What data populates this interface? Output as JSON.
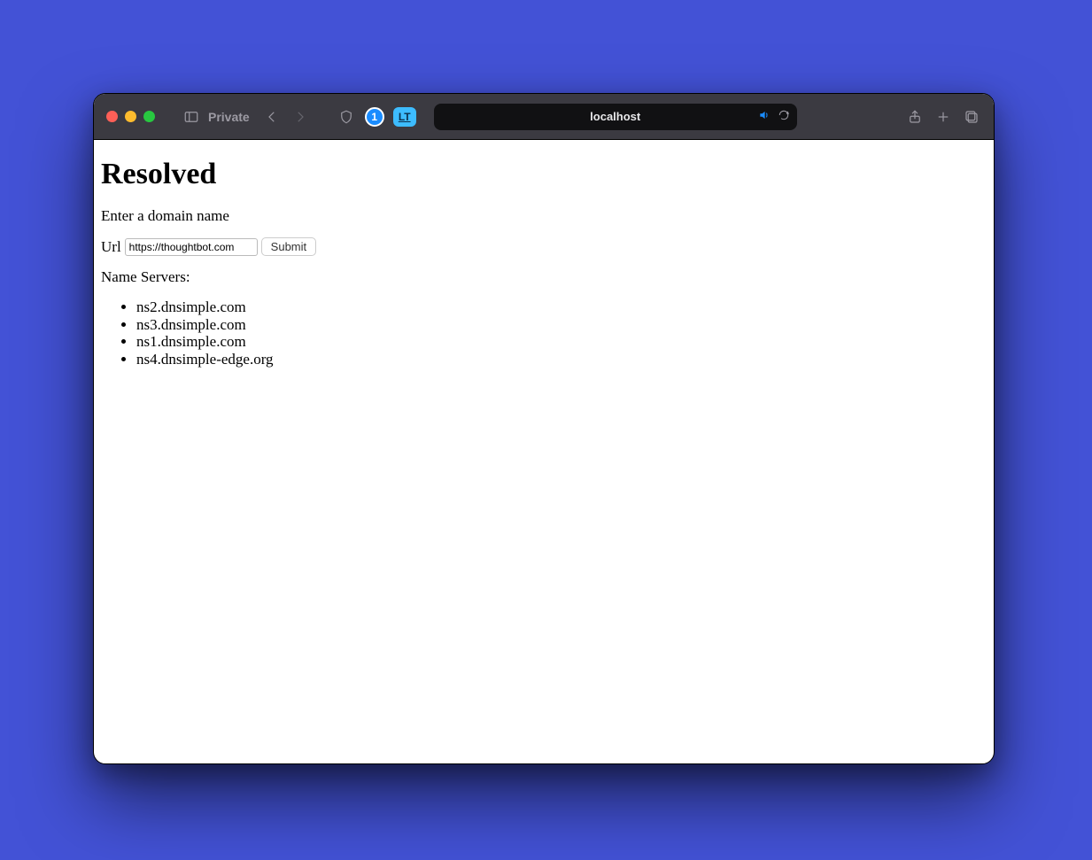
{
  "browser": {
    "mode_label": "Private",
    "address_text": "localhost"
  },
  "page": {
    "heading": "Resolved",
    "prompt": "Enter a domain name",
    "form": {
      "url_label": "Url",
      "url_value": "https://thoughtbot.com",
      "submit_label": "Submit"
    },
    "ns_heading": "Name Servers:",
    "name_servers": [
      "ns2.dnsimple.com",
      "ns3.dnsimple.com",
      "ns1.dnsimple.com",
      "ns4.dnsimple-edge.org"
    ]
  }
}
